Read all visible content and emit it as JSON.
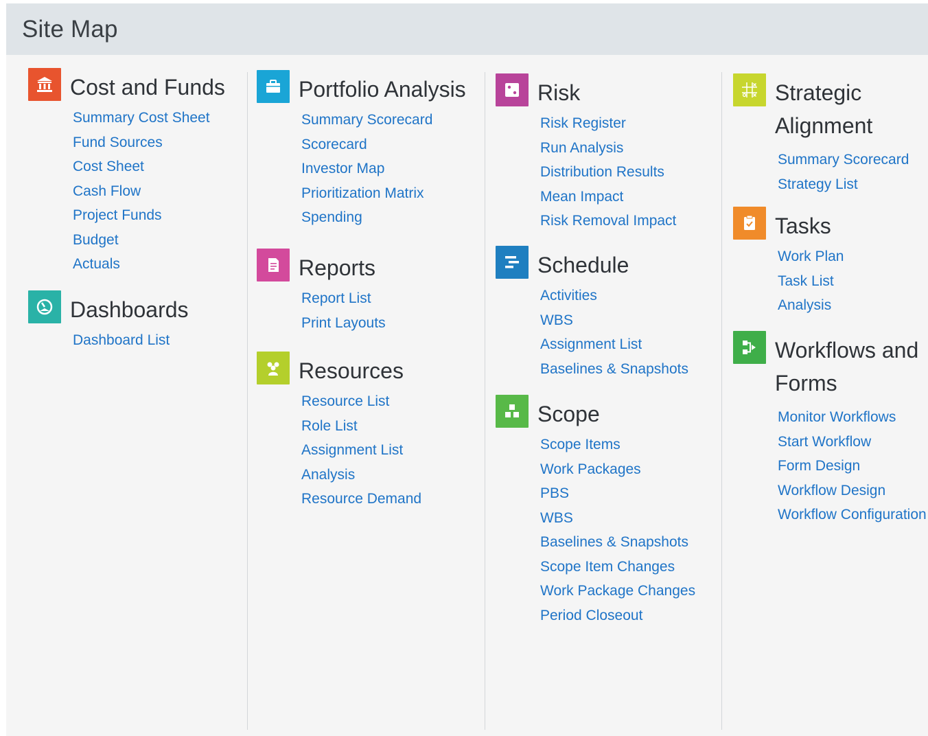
{
  "page": {
    "title": "Site Map"
  },
  "colors": {
    "header_bg": "#dfe4e8",
    "link": "#1f74c7",
    "cost_funds": "#e8542e",
    "dashboards": "#2ab2a7",
    "portfolio": "#1aa5d6",
    "reports": "#d34a9c",
    "resources": "#b4cf2c",
    "risk": "#b8449a",
    "schedule": "#1f7fc0",
    "scope": "#58b948",
    "strategic": "#c7d62e",
    "tasks": "#f08b2a",
    "workflows": "#3fae49"
  },
  "sections": {
    "cost_funds": {
      "title": "Cost and Funds",
      "icon": "bank-icon",
      "links": [
        "Summary Cost Sheet",
        "Fund Sources",
        "Cost Sheet",
        "Cash Flow",
        "Project Funds",
        "Budget",
        "Actuals"
      ]
    },
    "dashboards": {
      "title": "Dashboards",
      "icon": "dashboard-gauge-icon",
      "links": [
        "Dashboard List"
      ]
    },
    "portfolio": {
      "title": "Portfolio Analysis",
      "icon": "briefcase-icon",
      "links": [
        "Summary Scorecard",
        "Scorecard",
        "Investor Map",
        "Prioritization Matrix",
        "Spending"
      ]
    },
    "reports": {
      "title": "Reports",
      "icon": "document-icon",
      "links": [
        "Report List",
        "Print Layouts"
      ]
    },
    "resources": {
      "title": "Resources",
      "icon": "people-icon",
      "links": [
        "Resource List",
        "Role List",
        "Assignment List",
        "Analysis",
        "Resource Demand"
      ]
    },
    "risk": {
      "title": "Risk",
      "icon": "dice-icon",
      "links": [
        "Risk Register",
        "Run Analysis",
        "Distribution Results",
        "Mean Impact",
        "Risk Removal Impact"
      ]
    },
    "schedule": {
      "title": "Schedule",
      "icon": "gantt-icon",
      "links": [
        "Activities",
        "WBS",
        "Assignment List",
        "Baselines & Snapshots"
      ]
    },
    "scope": {
      "title": "Scope",
      "icon": "hierarchy-blocks-icon",
      "links": [
        "Scope Items",
        "Work Packages",
        "PBS",
        "WBS",
        "Baselines & Snapshots",
        "Scope Item Changes",
        "Work Package Changes",
        "Period Closeout"
      ]
    },
    "strategic": {
      "title": "Strategic Alignment",
      "icon": "tic-tac-toe-icon",
      "links": [
        "Summary Scorecard",
        "Strategy List"
      ]
    },
    "tasks": {
      "title": "Tasks",
      "icon": "clipboard-check-icon",
      "links": [
        "Work Plan",
        "Task List",
        "Analysis"
      ]
    },
    "workflows": {
      "title": "Workflows and Forms",
      "icon": "workflow-icon",
      "links": [
        "Monitor Workflows",
        "Start Workflow",
        "Form Design",
        "Workflow Design",
        "Workflow Configuration"
      ]
    }
  }
}
